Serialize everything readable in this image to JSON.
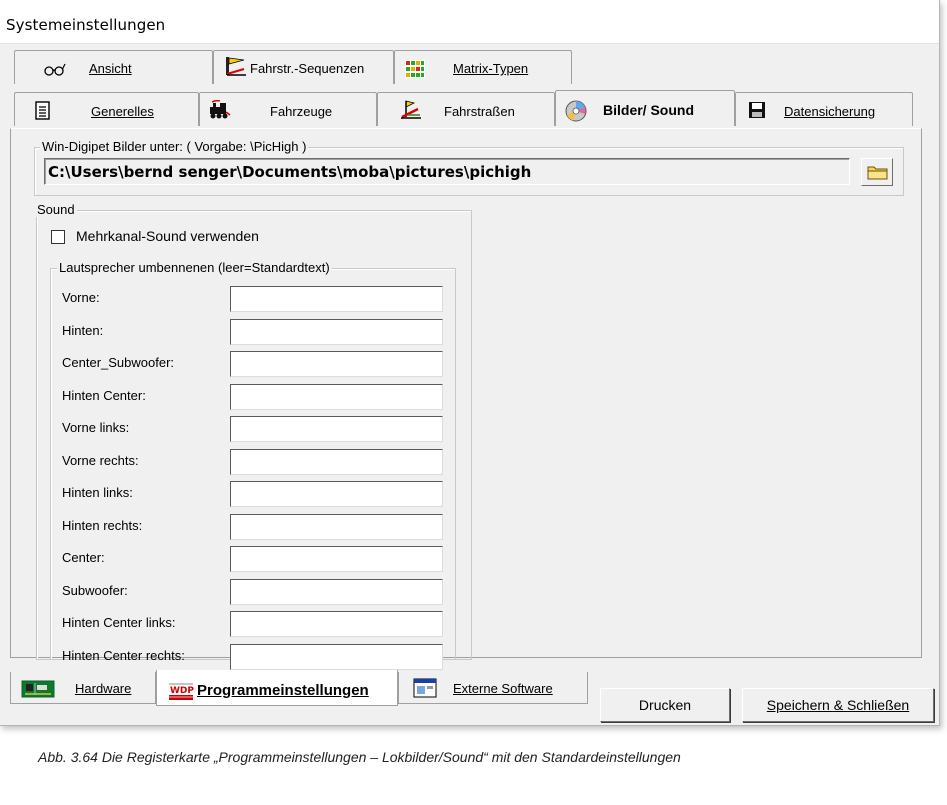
{
  "window": {
    "title": "Systemeinstellungen"
  },
  "tabs_row1": [
    {
      "label": "Ansicht",
      "icon": "glasses-icon"
    },
    {
      "label": "Fahrstr.-Sequenzen",
      "icon": "route-sequence-icon"
    },
    {
      "label": "Matrix-Typen",
      "icon": "matrix-grid-icon"
    }
  ],
  "tabs_row2": [
    {
      "label": "Generelles",
      "icon": "document-icon"
    },
    {
      "label": "Fahrzeuge",
      "icon": "locomotive-icon"
    },
    {
      "label": "Fahrstraßen",
      "icon": "route-flag-icon"
    },
    {
      "label": "Bilder/ Sound",
      "icon": "cd-disc-icon",
      "active": true
    },
    {
      "label": "Datensicherung",
      "icon": "floppy-disk-icon"
    }
  ],
  "pictures": {
    "legend": "Win-Digipet Bilder unter:   ( Vorgabe: \\PicHigh )",
    "path": "C:\\Users\\bernd senger\\Documents\\moba\\pictures\\pichigh",
    "browse_icon": "folder-icon"
  },
  "sound": {
    "legend": "Sound",
    "multichannel_label": "Mehrkanal-Sound verwenden",
    "multichannel_checked": false,
    "speakers_legend": "Lautsprecher umbennenen (leer=Standardtext)",
    "speakers": [
      {
        "label": "Vorne:",
        "value": ""
      },
      {
        "label": "Hinten:",
        "value": ""
      },
      {
        "label": "Center_Subwoofer:",
        "value": ""
      },
      {
        "label": "Hinten Center:",
        "value": ""
      },
      {
        "label": "Vorne links:",
        "value": ""
      },
      {
        "label": "Vorne rechts:",
        "value": ""
      },
      {
        "label": "Hinten links:",
        "value": ""
      },
      {
        "label": "Hinten rechts:",
        "value": ""
      },
      {
        "label": "Center:",
        "value": ""
      },
      {
        "label": "Subwoofer:",
        "value": ""
      },
      {
        "label": "Hinten Center links:",
        "value": ""
      },
      {
        "label": "Hinten Center rechts:",
        "value": ""
      }
    ]
  },
  "bottom_tabs": [
    {
      "label": "Hardware",
      "icon": "circuit-board-icon"
    },
    {
      "label": "Programmeinstellungen",
      "icon": "wdp-logo-icon",
      "active": true
    },
    {
      "label": "Externe Software",
      "icon": "window-app-icon"
    }
  ],
  "buttons": {
    "print": "Drucken",
    "save_close": "Speichern & Schließen"
  },
  "caption": "Abb. 3.64    Die Registerkarte „Programmeinstellungen – Lokbilder/Sound“ mit den Standardeinstellungen"
}
